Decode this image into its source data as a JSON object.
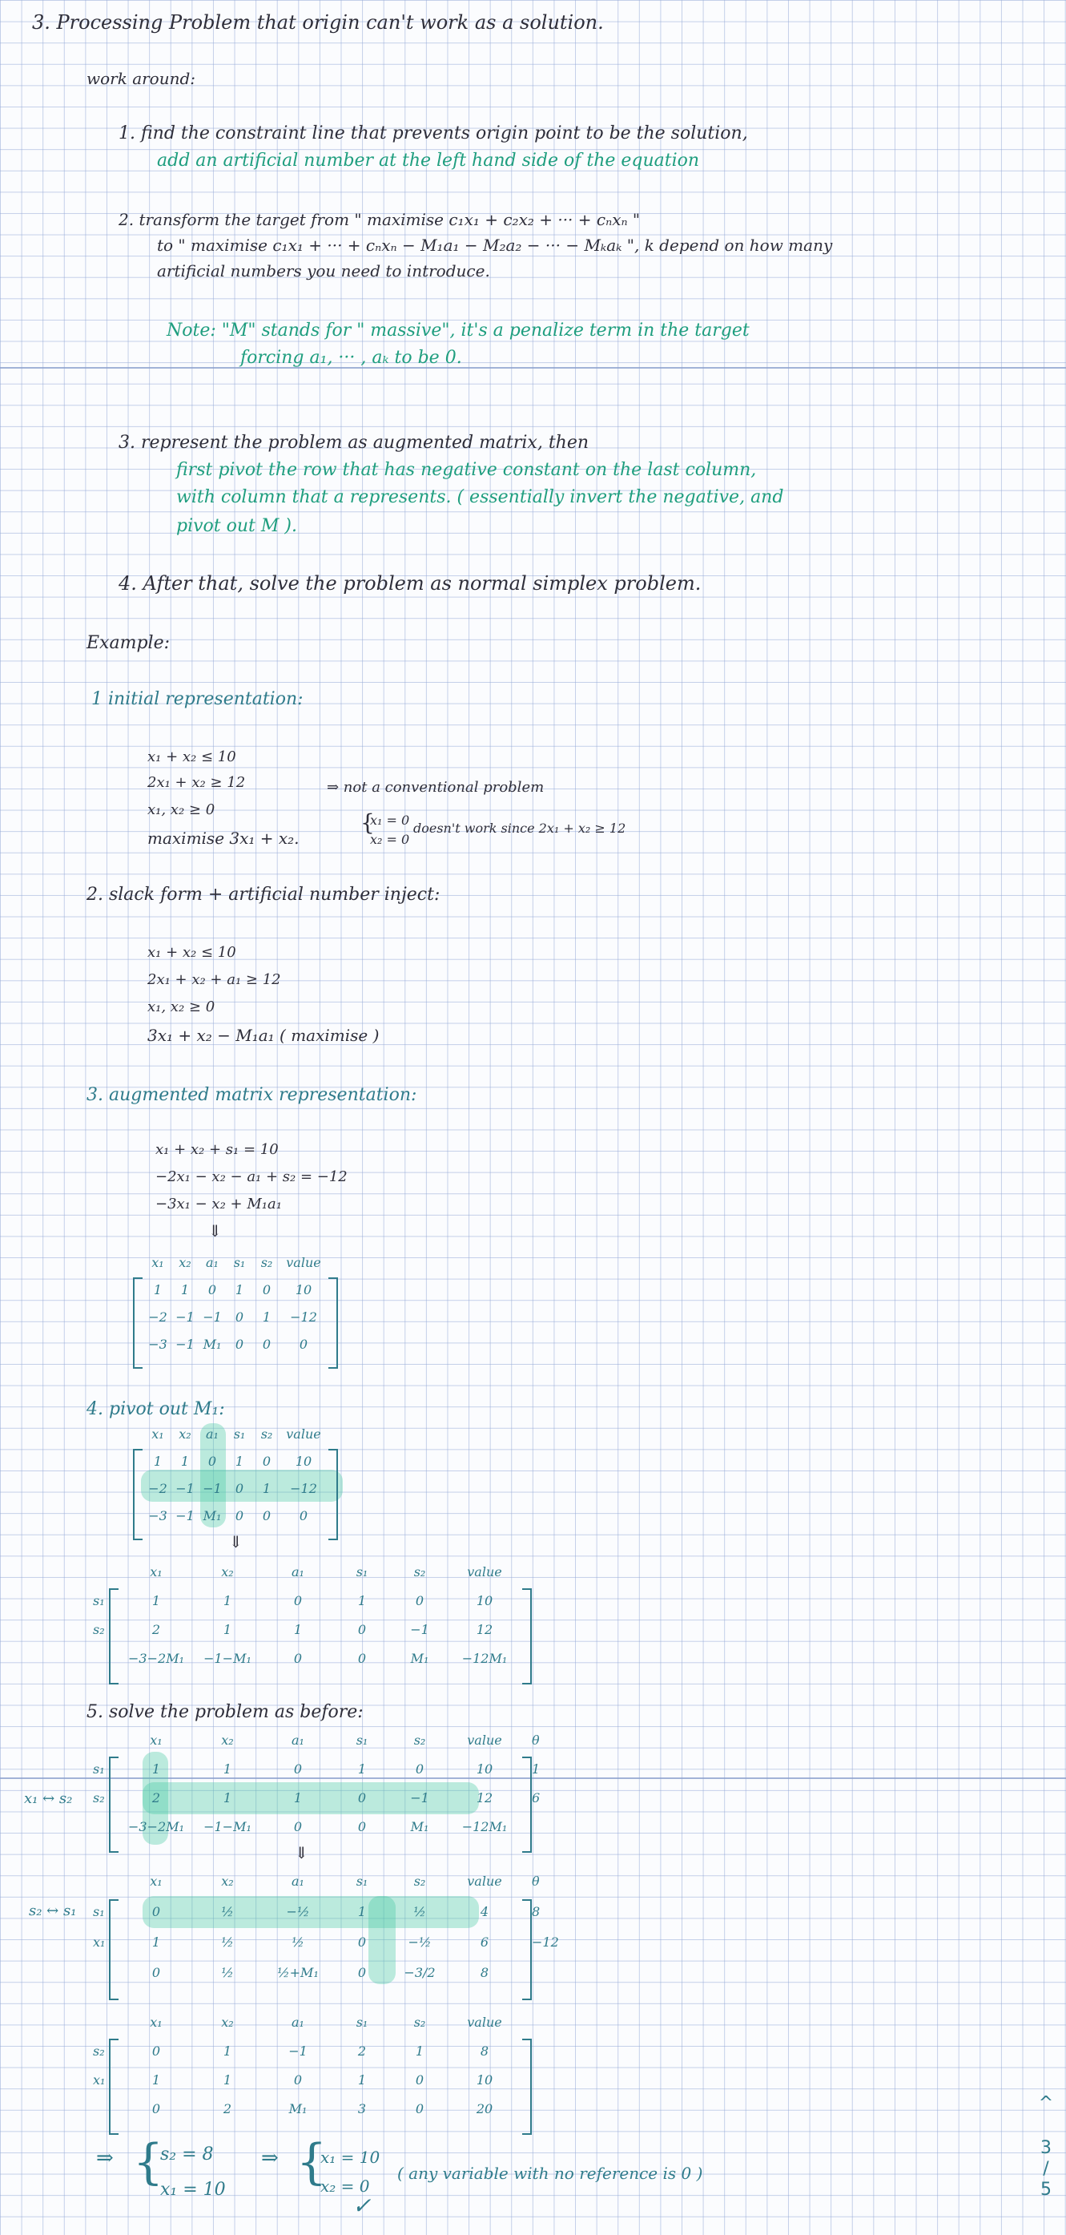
{
  "header": {
    "title": "3. Processing Problem that origin can't work as a solution.",
    "workaround": "work around:"
  },
  "steps": {
    "s1a": "1. find the constraint line that prevents origin point to be the solution,",
    "s1b": "add an artificial number at the left hand side of the equation",
    "s2a": "2. transform the target from \" maximise c₁x₁ + c₂x₂ + ··· + cₙxₙ \"",
    "s2b": "to \" maximise c₁x₁ + ··· + cₙxₙ − M₁a₁ − M₂a₂ − ··· − Mₖaₖ \",  k depend on how many",
    "s2c": "artificial numbers you need to introduce.",
    "note1": "Note: \"M\" stands for \" massive\",  it's a penalize term in the target",
    "note2": "forcing a₁, ··· , aₖ to be 0.",
    "s3a": "3. represent the problem as augmented matrix, then",
    "s3b": "first pivot the row that has negative constant on the last column,",
    "s3c": "with column that a represents. ( essentially invert the negative, and",
    "s3d": "pivot out M ).",
    "s4": "4. After that, solve the problem as normal simplex problem."
  },
  "example": {
    "title": "Example:",
    "e1": "1  initial representation:",
    "e1_l1": "x₁ + x₂ ≤ 10",
    "e1_l2": "2x₁ + x₂ ≥ 12",
    "e1_l3": "x₁, x₂ ≥ 0",
    "e1_l4": "maximise 3x₁ + x₂.",
    "e1_arrow": "⇒ not a conventional problem",
    "e1_orig1": "x₁ = 0",
    "e1_orig2": "x₂ = 0",
    "e1_orig_note": "doesn't work since 2x₁ + x₂ ≥ 12",
    "e2": "2.  slack form + artificial number inject:",
    "e2_l1": "x₁ + x₂ ≤ 10",
    "e2_l2": "2x₁ + x₂ + a₁ ≥ 12",
    "e2_l3": "x₁, x₂ ≥ 0",
    "e2_l4": "3x₁ + x₂ − M₁a₁   ( maximise )",
    "e3": "3.  augmented matrix representation:",
    "e3_l1": "x₁ + x₂ + s₁ = 10",
    "e3_l2": "−2x₁ − x₂ − a₁ + s₂ = −12",
    "e3_l3": "−3x₁ − x₂ + M₁a₁",
    "e3_down": "⇓",
    "e4": "4.  pivot out M₁:",
    "e4_down": "⇓",
    "e5": "5.  solve the problem as before:",
    "e5_down": "⇓",
    "theta": "θ",
    "swap1": "x₁ ↔ s₂",
    "swap2": "s₂ ↔ s₁"
  },
  "matrix_headers": {
    "short": [
      "x₁",
      "x₂",
      "a₁",
      "s₁",
      "s₂",
      "value"
    ],
    "long": [
      "x₁",
      "x₂",
      "a₁",
      "s₁",
      "s₂",
      "value"
    ]
  },
  "matrices": {
    "m3": [
      [
        "1",
        "1",
        "0",
        "1",
        "0",
        "10"
      ],
      [
        "−2",
        "−1",
        "−1",
        "0",
        "1",
        "−12"
      ],
      [
        "−3",
        "−1",
        "M₁",
        "0",
        "0",
        "0"
      ]
    ],
    "m4": [
      [
        "1",
        "1",
        "0",
        "1",
        "0",
        "10"
      ],
      [
        "−2",
        "−1",
        "−1",
        "0",
        "1",
        "−12"
      ],
      [
        "−3",
        "−1",
        "M₁",
        "0",
        "0",
        "0"
      ]
    ],
    "m4b": {
      "labels": [
        "s₁",
        "s₂",
        ""
      ],
      "rows": [
        [
          "1",
          "1",
          "0",
          "1",
          "0",
          "10"
        ],
        [
          "2",
          "1",
          "1",
          "0",
          "−1",
          "12"
        ],
        [
          "−3−2M₁",
          "−1−M₁",
          "0",
          "0",
          "M₁",
          "−12M₁"
        ]
      ]
    },
    "m5a": {
      "labels": [
        "s₁",
        "s₂",
        ""
      ],
      "rows": [
        [
          "1",
          "1",
          "0",
          "1",
          "0",
          "10"
        ],
        [
          "2",
          "1",
          "1",
          "0",
          "−1",
          "12"
        ],
        [
          "−3−2M₁",
          "−1−M₁",
          "0",
          "0",
          "M₁",
          "−12M₁"
        ]
      ],
      "theta": [
        "1",
        "6",
        ""
      ]
    },
    "m5b": {
      "labels": [
        "s₁",
        "x₁",
        ""
      ],
      "rows": [
        [
          "0",
          "½",
          "−½",
          "1",
          "½",
          "4"
        ],
        [
          "1",
          "½",
          "½",
          "0",
          "−½",
          "6"
        ],
        [
          "0",
          "½",
          "½+M₁",
          "0",
          "−3/2",
          "8"
        ]
      ],
      "theta": [
        "8",
        "−12",
        ""
      ]
    },
    "m5c": {
      "labels": [
        "s₂",
        "x₁",
        ""
      ],
      "rows": [
        [
          "0",
          "1",
          "−1",
          "2",
          "1",
          "8"
        ],
        [
          "1",
          "1",
          "0",
          "1",
          "0",
          "10"
        ],
        [
          "0",
          "2",
          "M₁",
          "3",
          "0",
          "20"
        ]
      ]
    }
  },
  "result": {
    "arrow1": "⇒",
    "r1": "s₂ = 8",
    "r2": "x₁ = 10",
    "arrow2": "⇒",
    "r3": "x₁ = 10",
    "r4": "x₂ = 0",
    "check": "✓",
    "note": "( any variable with no reference is 0 )"
  },
  "pager": {
    "up": "^",
    "current": "3",
    "divider": "/",
    "total": "5"
  }
}
